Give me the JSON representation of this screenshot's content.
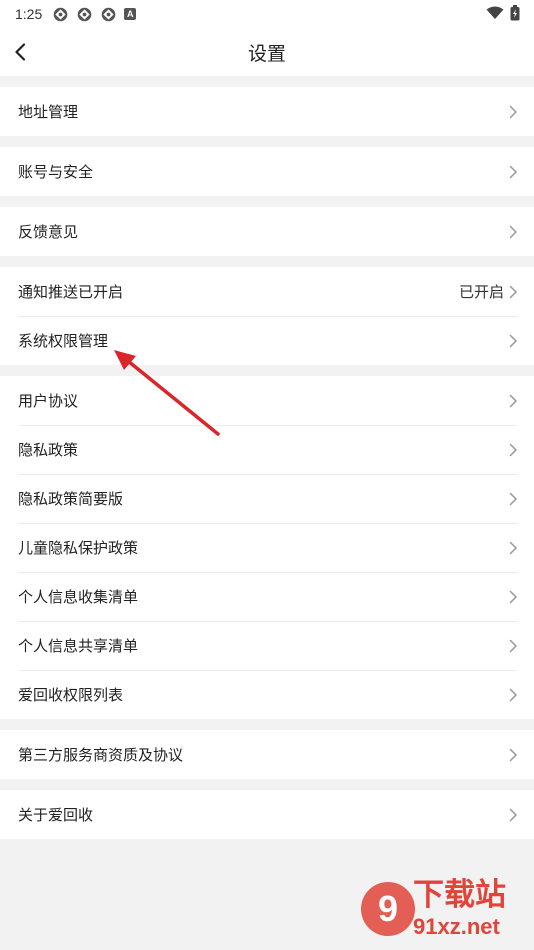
{
  "status": {
    "time": "1:25",
    "badge": "A"
  },
  "header": {
    "title": "设置"
  },
  "groups": [
    {
      "items": [
        {
          "label": "地址管理"
        }
      ]
    },
    {
      "items": [
        {
          "label": "账号与安全"
        }
      ]
    },
    {
      "items": [
        {
          "label": "反馈意见"
        }
      ]
    },
    {
      "items": [
        {
          "label": "通知推送已开启",
          "value": "已开启"
        },
        {
          "label": "系统权限管理"
        }
      ]
    },
    {
      "items": [
        {
          "label": "用户协议"
        },
        {
          "label": "隐私政策"
        },
        {
          "label": "隐私政策简要版"
        },
        {
          "label": "儿童隐私保护政策"
        },
        {
          "label": "个人信息收集清单"
        },
        {
          "label": "个人信息共享清单"
        },
        {
          "label": "爱回收权限列表"
        }
      ]
    },
    {
      "items": [
        {
          "label": "第三方服务商资质及协议"
        }
      ]
    },
    {
      "items": [
        {
          "label": "关于爱回收"
        }
      ]
    }
  ],
  "watermark": {
    "text_top": "下载站",
    "text_bottom": "91xz.net"
  },
  "colors": {
    "annotation_arrow": "#d9262a",
    "watermark_red": "#e0443a"
  }
}
